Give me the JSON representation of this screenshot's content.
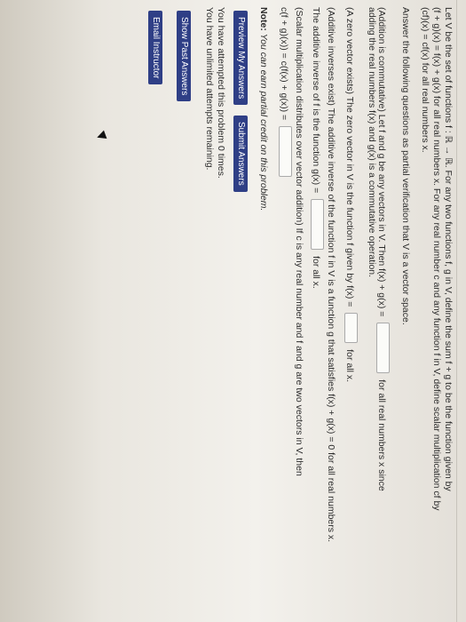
{
  "problem": {
    "intro_1": "Let V be the set of functions f : ℝ → ℝ. For any two functions f, g in V, define the sum f + g to be the function given by",
    "intro_2": "(f + g)(x) = f(x) + g(x) for all real numbers x. For any real number c and any function f in V, define scalar multiplication cf by",
    "intro_3": "(cf)(x) = cf(x) for all real numbers x.",
    "answer_prompt": "Answer the following questions as partial verification that V is a vector space.",
    "q1_a": "(Addition is commutative) Let f and g be any vectors in V. Then f(x) + g(x) =",
    "q1_b": "for all real numbers x since",
    "q1_c": "adding the real numbers f(x) and g(x) is a commutative operation.",
    "q2_a": "(A zero vector exists) The zero vector in V is the function f given by f(x) =",
    "q2_b": "for all x.",
    "q3_a": "(Additive inverses exist) The additive inverse of the function f in V is a function g that satisfies f(x) + g(x) = 0 for all real numbers x.",
    "q3_b": "The additive inverse of f is the function g(x) =",
    "q3_c": "for all x.",
    "q4_a": "(Scalar multiplication distributes over vector addition) If c is any real number and f and g are two vectors in V, then",
    "q4_b": "c(f + g)(x)) = c(f(x) + g(x)) =",
    "inputs": {
      "q1": "",
      "q2": "",
      "q3": "",
      "q4": ""
    }
  },
  "note": {
    "label": "Note:",
    "text": "You can earn partial credit on this problem."
  },
  "buttons": {
    "preview": "Preview My Answers",
    "submit": "Submit Answers",
    "show_past": "Show Past Answers",
    "email": "Email Instructor"
  },
  "status": {
    "attempted": "You have attempted this problem 0 times.",
    "remaining": "You have unlimited attempts remaining."
  },
  "colors": {
    "button": "#2f3f86"
  }
}
